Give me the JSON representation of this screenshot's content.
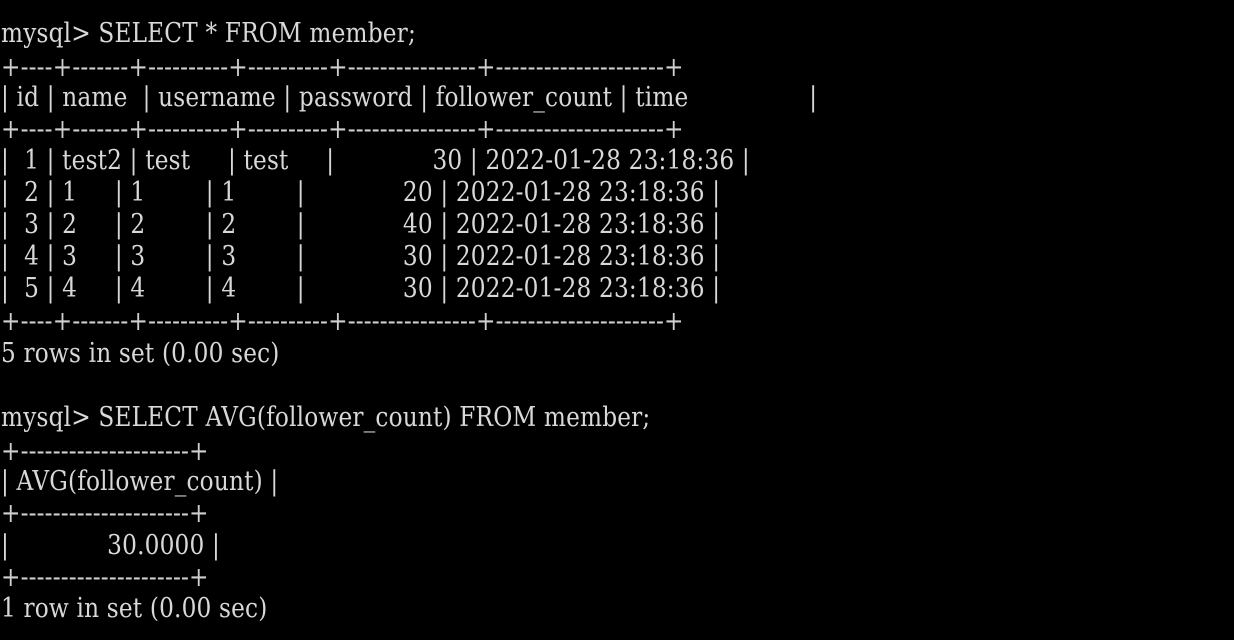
{
  "terminal": {
    "lines": [
      {
        "type": "prompt",
        "text": "mysql> SELECT * FROM member;"
      },
      {
        "type": "border",
        "text": "+----+-------+----------+----------+----------------+---------------------+"
      },
      {
        "type": "row",
        "text": "| id | name  | username | password | follower_count | time                |"
      },
      {
        "type": "border",
        "text": "+----+-------+----------+----------+----------------+---------------------+"
      },
      {
        "type": "row",
        "text": "|  1 | test2 | test     | test     |             30 | 2022-01-28 23:18:36 |"
      },
      {
        "type": "row",
        "text": "|  2 | 1     | 1        | 1        |             20 | 2022-01-28 23:18:36 |"
      },
      {
        "type": "row",
        "text": "|  3 | 2     | 2        | 2        |             40 | 2022-01-28 23:18:36 |"
      },
      {
        "type": "row",
        "text": "|  4 | 3     | 3        | 3        |             30 | 2022-01-28 23:18:36 |"
      },
      {
        "type": "row",
        "text": "|  5 | 4     | 4        | 4        |             30 | 2022-01-28 23:18:36 |"
      },
      {
        "type": "border",
        "text": "+----+-------+----------+----------+----------------+---------------------+"
      },
      {
        "type": "status",
        "text": "5 rows in set (0.00 sec)"
      },
      {
        "type": "blank",
        "text": ""
      },
      {
        "type": "prompt",
        "text": "mysql> SELECT AVG(follower_count) FROM member;"
      },
      {
        "type": "border",
        "text": "+---------------------+"
      },
      {
        "type": "row",
        "text": "| AVG(follower_count) |"
      },
      {
        "type": "border",
        "text": "+---------------------+"
      },
      {
        "type": "row",
        "text": "|             30.0000 |"
      },
      {
        "type": "border",
        "text": "+---------------------+"
      },
      {
        "type": "status",
        "text": "1 row in set (0.00 sec)"
      }
    ]
  },
  "colors": {
    "background": "#000000",
    "text": "#d8d8d8"
  }
}
